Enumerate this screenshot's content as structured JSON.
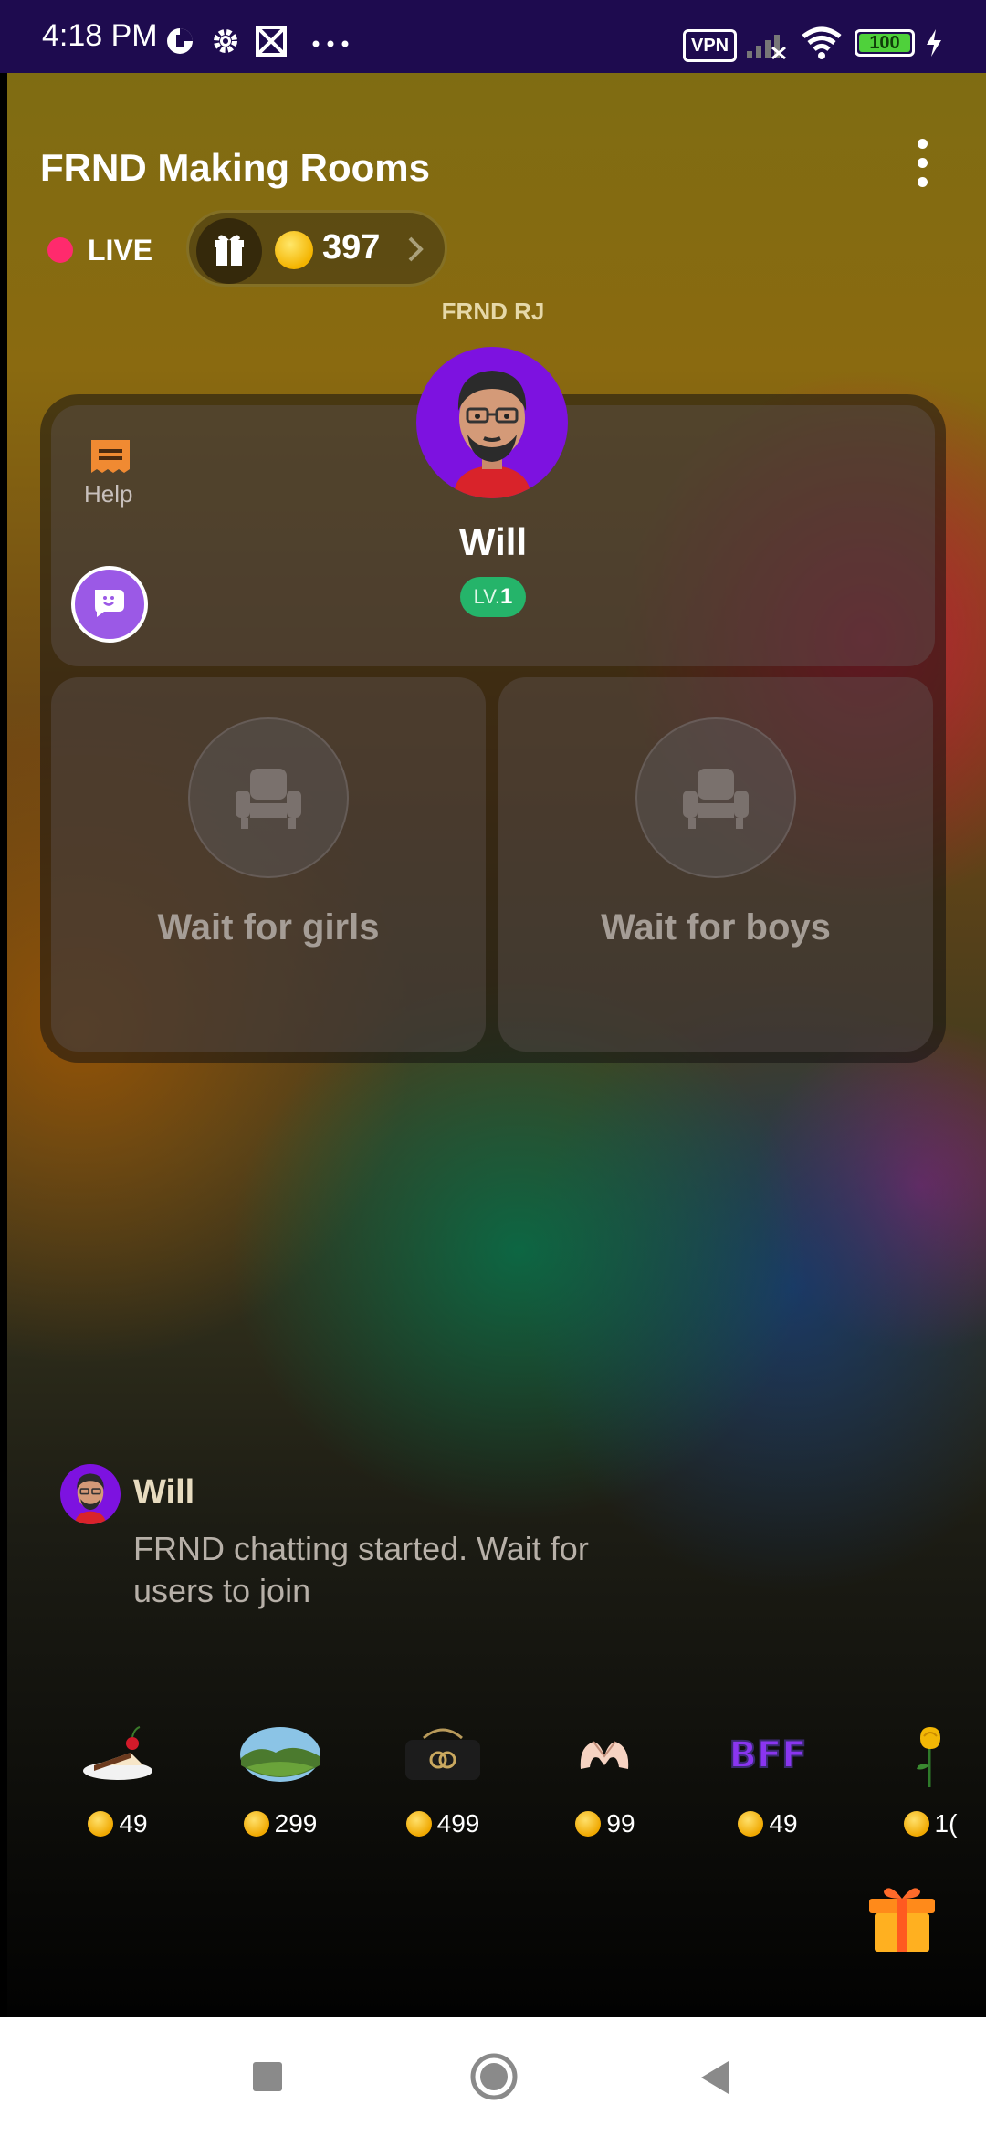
{
  "status_bar": {
    "time": "4:18 PM",
    "icons": [
      "data-saver-icon",
      "settings-gear-icon",
      "screenshot-icon",
      "more-dots-icon"
    ],
    "vpn": "VPN",
    "battery": "100"
  },
  "room": {
    "title": "FRND Making Rooms",
    "live_label": "LIVE",
    "coins": "397",
    "rj_label": "FRND RJ",
    "help_label": "Help"
  },
  "host": {
    "name": "Will",
    "level_prefix": "LV.",
    "level": "1"
  },
  "seats": {
    "girls_label": "Wait for girls",
    "boys_label": "Wait for boys"
  },
  "chat": {
    "messages": [
      {
        "name": "Will",
        "text": "FRND chatting started. Wait for users to join"
      }
    ]
  },
  "gifts": [
    {
      "icon": "cake-icon",
      "price": "49"
    },
    {
      "icon": "landscape-icon",
      "price": "299"
    },
    {
      "icon": "designer-handbag-icon",
      "price": "499"
    },
    {
      "icon": "heart-hands-icon",
      "price": "99"
    },
    {
      "icon": "bff-text-icon",
      "price": "49"
    },
    {
      "icon": "rose-icon",
      "price": "1("
    }
  ],
  "colors": {
    "status_bar": "#1e0b4f",
    "live_dot": "#ff2a6d",
    "avatar_bg": "#7d12e0",
    "level_badge": "#25b46a",
    "chat_button": "#9b59e6"
  }
}
